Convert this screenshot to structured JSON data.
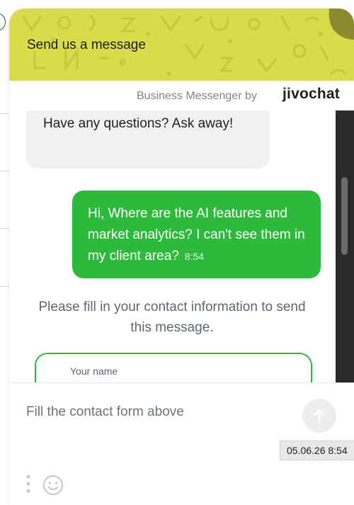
{
  "widget": {
    "header_title": "Send us a message",
    "branding_text": "Business Messenger by",
    "brand_logo": "jivochat",
    "accent_color": "#2dba3c",
    "header_color": "#dadb4b"
  },
  "messages": [
    {
      "direction": "incoming",
      "text": "Have any questions? Ask away!"
    },
    {
      "direction": "outgoing",
      "text": "Hi, Where are the AI features and market analytics? I can't see them in my client area?",
      "time": "8:54"
    }
  ],
  "notice": "Please fill in your contact information to send this message.",
  "contact_form": {
    "name_label": "Your name"
  },
  "composer": {
    "placeholder": "Fill the contact form above"
  },
  "tooltip": "05.06.26 8:54",
  "icons": {
    "scroll_down": "chevron-down-icon",
    "send": "arrow-up-icon",
    "menu": "vertical-dots-icon",
    "emoji": "smiley-icon"
  }
}
